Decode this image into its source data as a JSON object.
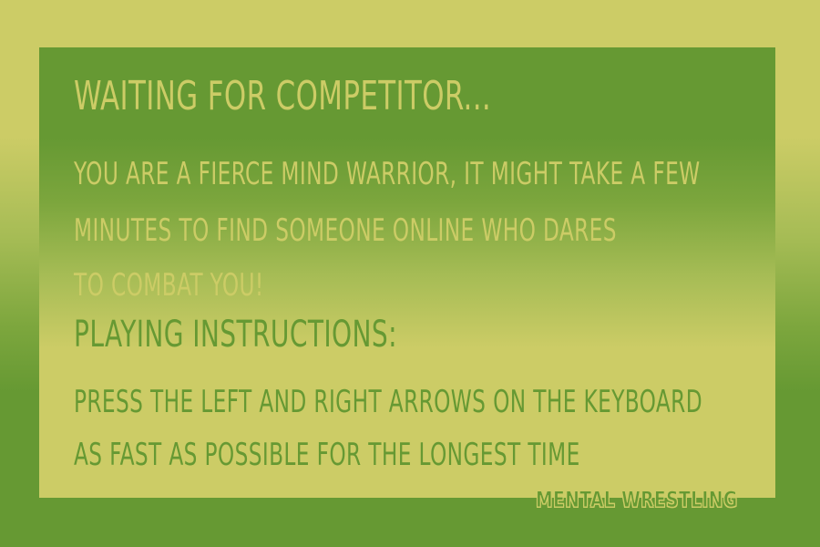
{
  "waiting": {
    "title": "Waiting for competitor...",
    "message_lines": [
      "You are a fierce mind warrior, it might take a few",
      "minutes to find someone online who dares",
      "to combat you!"
    ]
  },
  "instructions": {
    "title": "Playing instructions:",
    "lines": [
      "Press the left and right arrows on the keyboard",
      "as fast as possible for the longest time"
    ]
  },
  "logo_text": "Mental Wrestling",
  "colors": {
    "yellow": "#cccc66",
    "green": "#669933"
  }
}
